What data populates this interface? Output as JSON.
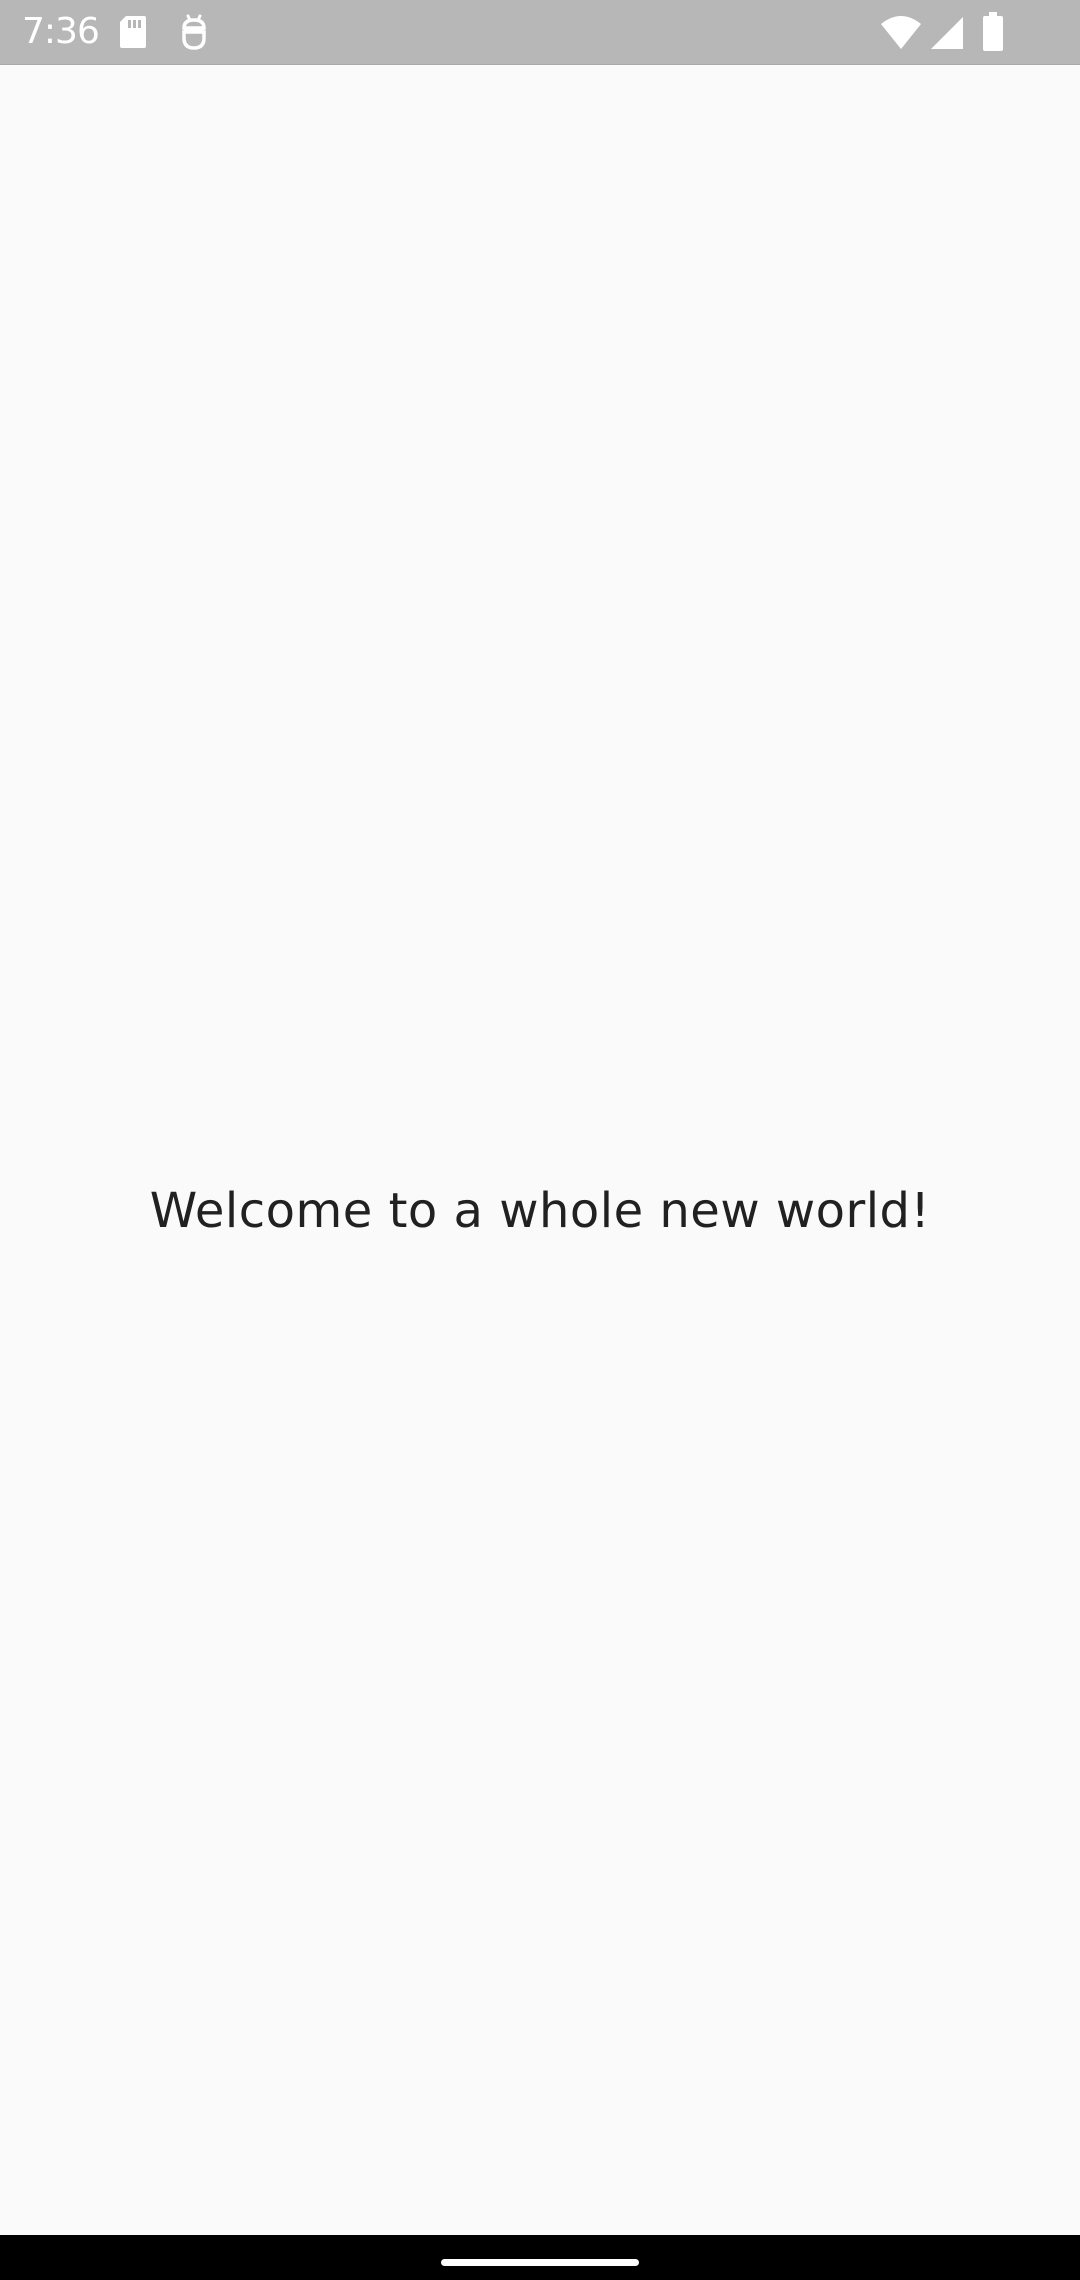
{
  "status_bar": {
    "time": "7:36",
    "icons": [
      "sd-card-icon",
      "debug-icon",
      "wifi-icon",
      "cell-signal-icon",
      "battery-icon"
    ]
  },
  "main": {
    "welcome_text": "Welcome to a whole new world!"
  },
  "colors": {
    "status_bar_bg": "#b7b7b7",
    "background": "#fafafa",
    "text": "#212121",
    "nav_bar_bg": "#000000",
    "home_handle": "#ffffff"
  }
}
